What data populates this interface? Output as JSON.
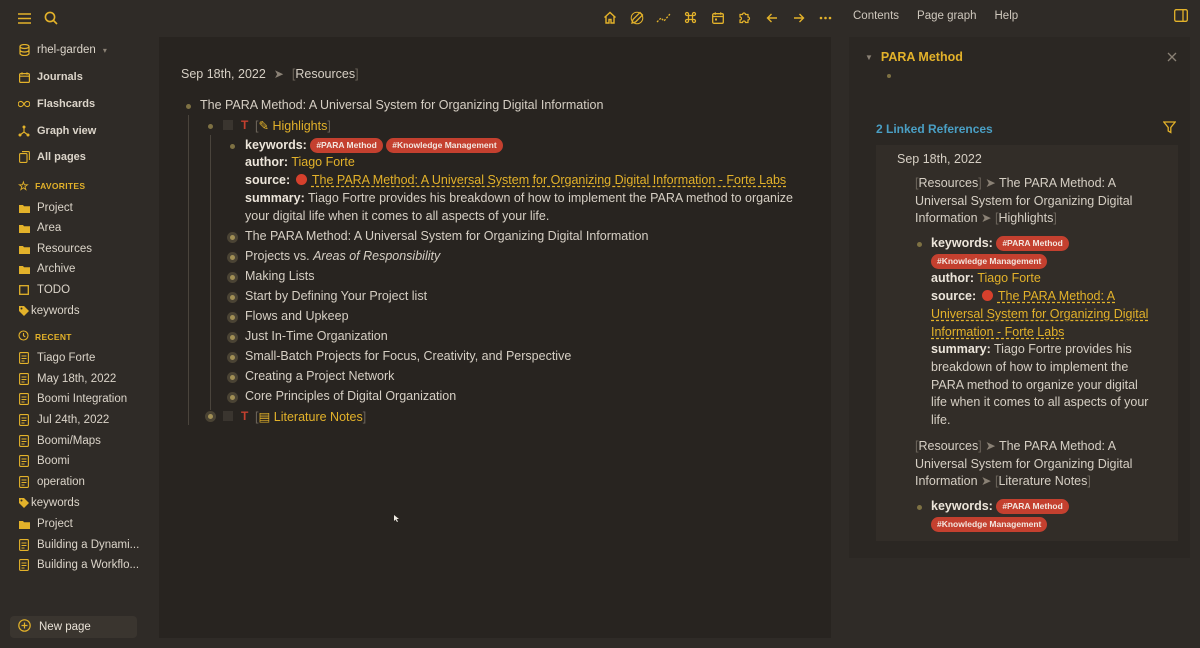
{
  "sidebar": {
    "graph_name": "rhel-garden",
    "nav": [
      {
        "label": "Journals",
        "icon": "calendar-icon"
      },
      {
        "label": "Flashcards",
        "icon": "infinity-icon"
      },
      {
        "label": "Graph view",
        "icon": "graph-icon"
      },
      {
        "label": "All pages",
        "icon": "pages-icon"
      }
    ],
    "favorites_title": "FAVORITES",
    "favorites": [
      {
        "label": "Project",
        "icon": "folder-icon"
      },
      {
        "label": "Area",
        "icon": "folder-icon"
      },
      {
        "label": "Resources",
        "icon": "folder-icon"
      },
      {
        "label": "Archive",
        "icon": "folder-icon"
      },
      {
        "label": "TODO",
        "icon": "square-icon"
      },
      {
        "label": "keywords",
        "icon": "tag-icon"
      }
    ],
    "recent_title": "RECENT",
    "recent": [
      {
        "label": "Tiago Forte",
        "icon": "page-icon"
      },
      {
        "label": "May 18th, 2022",
        "icon": "page-icon"
      },
      {
        "label": "Boomi Integration",
        "icon": "page-icon"
      },
      {
        "label": "Jul 24th, 2022",
        "icon": "page-icon"
      },
      {
        "label": "Boomi/Maps",
        "icon": "page-icon"
      },
      {
        "label": "Boomi",
        "icon": "page-icon"
      },
      {
        "label": "operation",
        "icon": "page-icon"
      },
      {
        "label": "keywords",
        "icon": "tag-icon"
      },
      {
        "label": "Project",
        "icon": "folder-icon"
      },
      {
        "label": "Building a Dynami...",
        "icon": "page-icon"
      },
      {
        "label": "Building a Workflo...",
        "icon": "page-icon"
      }
    ],
    "new_page": "New page"
  },
  "header": {
    "menu": [
      "Contents",
      "Page graph",
      "Help"
    ]
  },
  "main": {
    "breadcrumb_date": "Sep 18th, 2022",
    "breadcrumb_page": "Resources",
    "block_title": "The PARA Method: A Universal System for Organizing Digital Information",
    "highlights_marker": "T",
    "highlights_label": "Highlights",
    "keywords_key": "keywords:",
    "tag1": "#PARA Method",
    "tag2": "#Knowledge Management",
    "author_key": "author:",
    "author_value": "Tiago Forte",
    "source_key": "source:",
    "source_value": "The PARA Method: A Universal System for Organizing Digital Information - Forte Labs",
    "summary_key": "summary:",
    "summary_line1": "Tiago Fortre provides his breakdown of how to implement the PARA method to organize",
    "summary_line2": "your digital life when it comes to all aspects of your life.",
    "items": [
      "The PARA Method: A Universal System for Organizing Digital Information",
      "Projects vs. ",
      "Making Lists",
      "Start by Defining Your Project list",
      "Flows and Upkeep",
      "Just In-Time Organization",
      "Small-Batch Projects for Focus, Creativity, and Perspective",
      "Creating a Project Network",
      "Core Principles of Digital Organization"
    ],
    "italic_suffix": "Areas of Responsibility",
    "lit_marker": "T",
    "lit_label": "Literature Notes"
  },
  "right_panel": {
    "title": "PARA Method",
    "linked_refs": "2 Linked References",
    "ref_date": "Sep 18th, 2022",
    "path1_a": "Resources",
    "path1_b": "The PARA Method: A",
    "path1_c": "Universal System for Organizing Digital",
    "path1_d": "Information",
    "path1_e": "Highlights",
    "keywords_key": "keywords:",
    "tag1": "#PARA Method",
    "tag2": "#Knowledge Management",
    "author_key": "author:",
    "author_value": "Tiago Forte",
    "source_key": "source:",
    "source_l1": "The PARA Method: A",
    "source_l2": "Universal System for Organizing Digital",
    "source_l3": "Information - Forte Labs",
    "summary_key": "summary:",
    "summary_l1": "Tiago Fortre provides his",
    "summary_l2": "breakdown of how to implement the",
    "summary_l3": "PARA method to organize your digital",
    "summary_l4": "life when it comes to all aspects of your",
    "summary_l5": "life.",
    "path2_a": "Resources",
    "path2_b": "The PARA Method: A",
    "path2_c": "Universal System for Organizing Digital",
    "path2_d": "Information",
    "path2_e": "Literature Notes",
    "keywords2_key": "keywords:",
    "tag3": "#PARA Method",
    "tag4": "#Knowledge Management"
  }
}
